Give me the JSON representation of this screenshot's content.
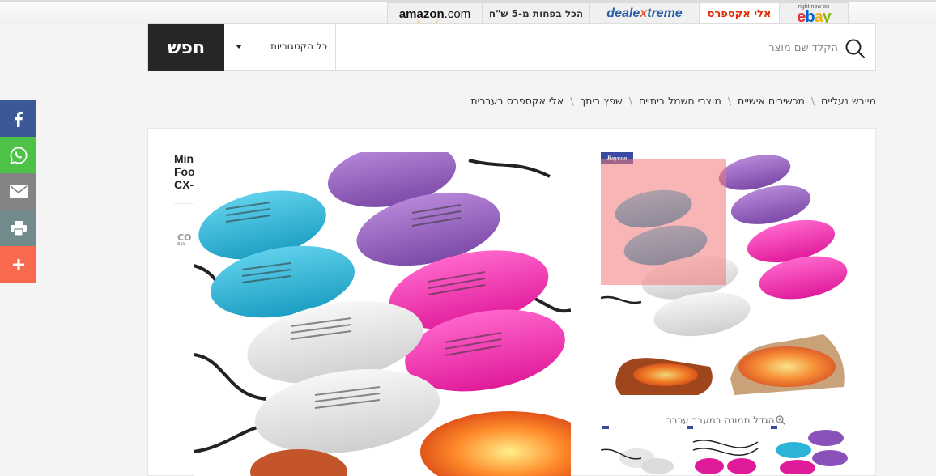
{
  "store_tabs": [
    {
      "label": "amazon",
      "label_suffix": ".com"
    },
    {
      "label": "הכל בפחות מ-5 ש\"ח"
    },
    {
      "label_a": "deale",
      "label_b": "x",
      "label_c": "treme"
    },
    {
      "label": "אלי אקספרס"
    },
    {
      "note": "right now on",
      "logo": [
        "e",
        "b",
        "a",
        "y"
      ]
    }
  ],
  "search": {
    "button_label": "חפש",
    "category_label": "כל הקטגוריות",
    "placeholder": "הקלד שם מוצר"
  },
  "breadcrumb": [
    "אלי אקספרס בעברית",
    "שפץ ביתך",
    "מוצרי חשמל ביתיים",
    "מכשירים אישיים",
    "מייבש נעליים"
  ],
  "breadcrumb_separator": "\\",
  "share": {
    "icons": [
      "facebook-icon",
      "whatsapp-icon",
      "email-icon",
      "print-icon",
      "more-icon"
    ]
  },
  "product": {
    "title_lines": [
      "Mini",
      "Foo",
      "CX-"
    ],
    "seller_logo": "CO",
    "seller_logo_sub": "SSL",
    "brand_badge": "Raycoo",
    "zoom_hint": "הגדל תמונה במעבר עכבר"
  },
  "colors": {
    "facebook": "#3b5998",
    "whatsapp": "#4dc247",
    "email": "#848484",
    "print": "#738a8d",
    "more": "#f8694d",
    "search_button": "#262626",
    "aliexpress": "#e62e04"
  }
}
